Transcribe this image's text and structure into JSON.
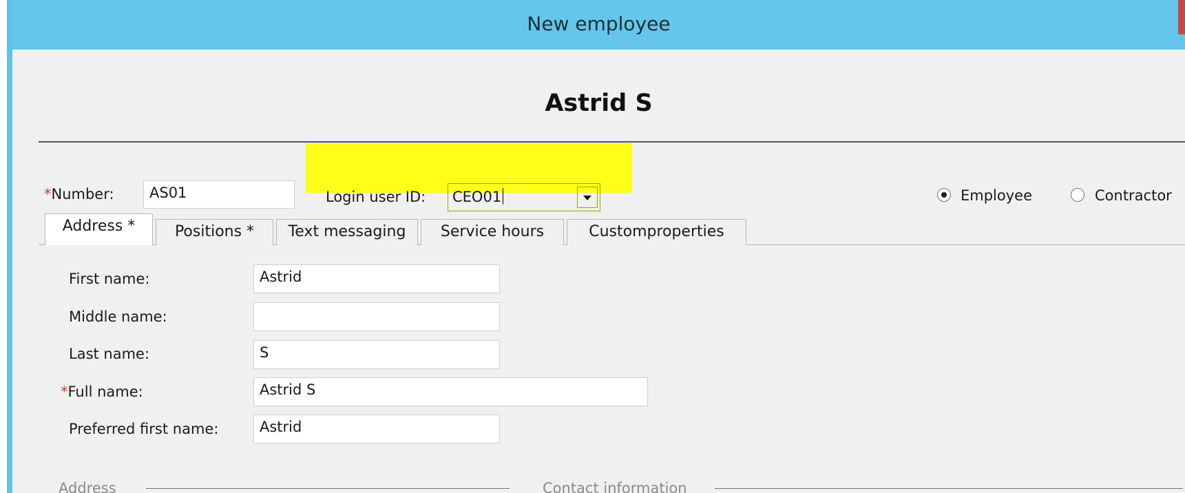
{
  "window": {
    "title": "New employee"
  },
  "header": {
    "employee_name": "Astrid S"
  },
  "top_fields": {
    "number_required_mark": "*",
    "number_label": "Number:",
    "number_value": "AS01",
    "login_label": "Login user ID:",
    "login_value": "CEO01",
    "highlight_color": "#ffff1a"
  },
  "worker_type": {
    "options": [
      {
        "label": "Employee",
        "selected": true
      },
      {
        "label": "Contractor",
        "selected": false
      }
    ]
  },
  "tabs": [
    {
      "label": "Address *",
      "active": true
    },
    {
      "label": "Positions *",
      "active": false
    },
    {
      "label": "Text messaging",
      "active": false
    },
    {
      "label": "Service hours",
      "active": false
    },
    {
      "label": "Customproperties",
      "active": false
    }
  ],
  "address_tab": {
    "first_name": {
      "label": "First name:",
      "value": "Astrid"
    },
    "middle_name": {
      "label": "Middle name:",
      "value": ""
    },
    "last_name": {
      "label": "Last name:",
      "value": "S"
    },
    "full_name": {
      "required_mark": "*",
      "label": "Full name:",
      "value": "Astrid S"
    },
    "preferred_first_name": {
      "label": "Preferred first name:",
      "value": "Astrid"
    }
  },
  "sections": {
    "address_label": "Address",
    "contact_label": "Contact information"
  },
  "colors": {
    "title_bar": "#63c6ea",
    "required": "#d9392b",
    "close_button": "#c74a42"
  }
}
